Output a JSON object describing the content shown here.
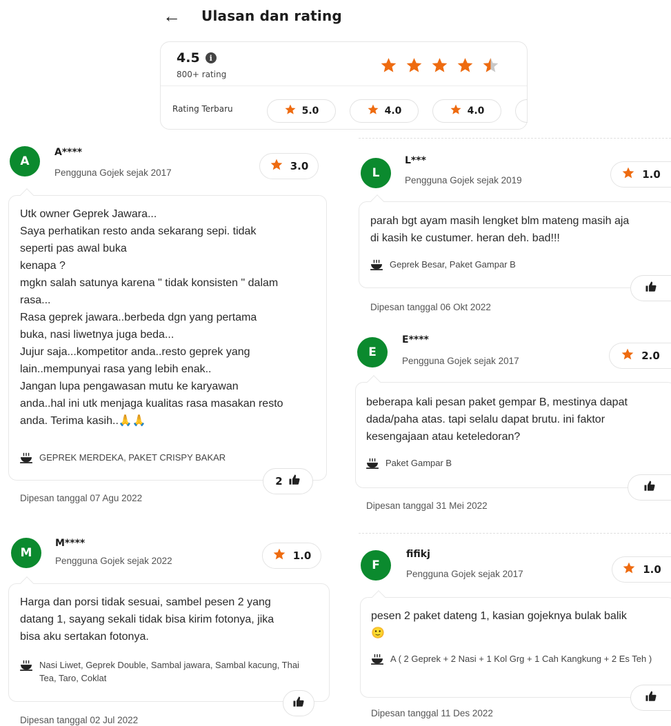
{
  "header": {
    "back_icon": "arrow-left-icon",
    "title": "Ulasan dan rating"
  },
  "summary": {
    "score": "4.5",
    "count": "800+ rating",
    "stars_value": 4.5,
    "recent_label": "Rating Terbaru",
    "recent_ratings": [
      "5.0",
      "4.0",
      "4.0"
    ]
  },
  "colors": {
    "star": "#ee6b10",
    "avatar": "#0b8a2e",
    "star_empty": "#c8c8c8"
  },
  "reviews": [
    {
      "initial": "A",
      "name": "A****",
      "since": "Pengguna Gojek sejak 2017",
      "rating": "3.0",
      "text": "Utk owner Geprek Jawara...\nSaya perhatikan resto anda sekarang sepi. tidak\nseperti pas awal buka\nkenapa ?\nmgkn salah satunya karena \" tidak konsisten \" dalam\nrasa...\nRasa geprek jawara..berbeda dgn yang pertama\nbuka, nasi liwetnya juga beda...\nJujur saja...kompetitor anda..resto geprek yang\nlain..mempunyai rasa yang lebih enak..\nJangan lupa pengawasan mutu ke karyawan\nanda..hal ini utk menjaga kualitas rasa masakan resto\nanda. Terima kasih..🙏🙏",
      "menu": "GEPREK MERDEKA, PAKET CRISPY BAKAR",
      "likes": "2",
      "date": "Dipesan tanggal 07 Agu 2022"
    },
    {
      "initial": "M",
      "name": "M****",
      "since": "Pengguna Gojek sejak 2022",
      "rating": "1.0",
      "text": "Harga dan porsi tidak sesuai, sambel pesen 2 yang\ndatang 1, sayang sekali tidak bisa kirim fotonya, jika\nbisa aku sertakan fotonya.",
      "menu": "Nasi Liwet, Geprek Double, Sambal jawara, Sambal\nkacung, Thai Tea, Taro, Coklat",
      "likes": "",
      "date": "Dipesan tanggal 02 Jul 2022"
    },
    {
      "initial": "L",
      "name": "L***",
      "since": "Pengguna Gojek sejak 2019",
      "rating": "1.0",
      "text": "parah bgt ayam masih lengket blm mateng masih aja\ndi kasih ke custumer. heran deh. bad!!!",
      "menu": "Geprek Besar, Paket Gampar B",
      "likes": "",
      "date": "Dipesan tanggal 06 Okt 2022"
    },
    {
      "initial": "E",
      "name": "E****",
      "since": "Pengguna Gojek sejak 2017",
      "rating": "2.0",
      "text": "beberapa kali pesan paket gempar B, mestinya dapat\ndada/paha atas. tapi selalu dapat brutu. ini faktor\nkesengajaan atau keteledoran?",
      "menu": "Paket Gampar B",
      "likes": "",
      "date": "Dipesan tanggal 31 Mei 2022"
    },
    {
      "initial": "F",
      "name": "fifikj",
      "since": "Pengguna Gojek sejak 2017",
      "rating": "1.0",
      "text": "pesen 2 paket dateng 1, kasian gojeknya bulak balik\n🙂",
      "menu": "A ( 2 Geprek + 2 Nasi + 1 Kol Grg + 1 Cah Kangkung + 2 Es\nTeh )",
      "likes": "",
      "date": "Dipesan tanggal 11 Des 2022"
    }
  ]
}
